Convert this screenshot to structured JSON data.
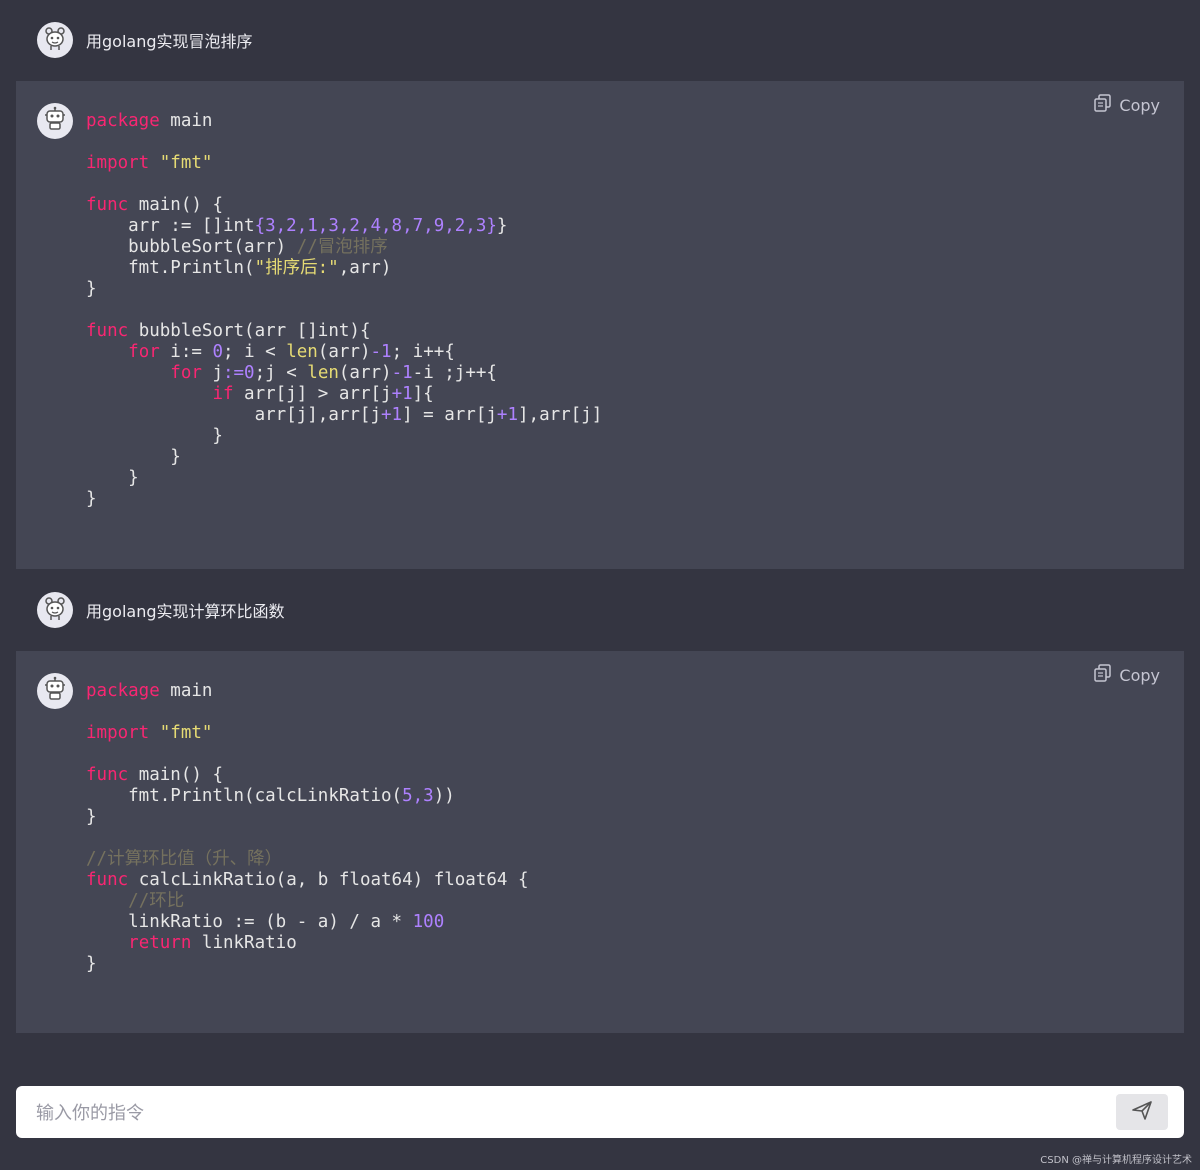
{
  "messages": [
    {
      "user_prompt": "用golang实现冒泡排序",
      "copy_label": "Copy"
    },
    {
      "user_prompt": "用golang实现计算环比函数",
      "copy_label": "Copy"
    }
  ],
  "code1": {
    "l1": [
      "package",
      " main"
    ],
    "l3": [
      "import",
      "\"fmt\""
    ],
    "l5": [
      "func",
      " main() {"
    ],
    "l6": [
      "    arr := []int",
      "{3,2,1,3,2,4,8,7,9,2,3}",
      "}"
    ],
    "l7": [
      "    bubbleSort(arr) ",
      "//冒泡排序"
    ],
    "l8": [
      "    fmt.Println(",
      "\"排序后:\"",
      ",arr)"
    ],
    "l9": "}",
    "l11": [
      "func",
      " bubbleSort(arr []int){"
    ],
    "l12": [
      "    ",
      "for",
      " i:= ",
      "0",
      "; i < ",
      "len",
      "(arr)",
      "-1",
      "; i++{"
    ],
    "l13": [
      "        ",
      "for",
      " j",
      ":=0",
      ";j < ",
      "len",
      "(arr)",
      "-1",
      "-i ;j++{"
    ],
    "l14": [
      "            ",
      "if",
      " arr[j] > arr[j",
      "+1",
      "]{"
    ],
    "l15": [
      "                arr[j],arr[j",
      "+1",
      "] = arr[j",
      "+1",
      "],arr[j]"
    ],
    "l16": "            }",
    "l17": "        }",
    "l18": "    }",
    "l19": "}"
  },
  "code2": {
    "l1": [
      "package",
      " main"
    ],
    "l3": [
      "import",
      "\"fmt\""
    ],
    "l5": [
      "func",
      " main() {"
    ],
    "l6": [
      "    fmt.Println(calcLinkRatio(",
      "5,3",
      "))"
    ],
    "l7": "}",
    "l9": "//计算环比值（升、降）",
    "l10": [
      "func",
      " calcLinkRatio(a, b float64) float64 {"
    ],
    "l11": [
      "    ",
      "//环比"
    ],
    "l12": [
      "    linkRatio := (b - a) / a * ",
      "100"
    ],
    "l13": [
      "    ",
      "return",
      " linkRatio"
    ],
    "l14": "}"
  },
  "input": {
    "placeholder": "输入你的指令"
  },
  "icons": {
    "user_avatar": "robot-face-icon",
    "bot_avatar": "robot-icon",
    "copy": "copy-icon",
    "send": "send-icon"
  },
  "watermark": "CSDN @禅与计算机程序设计艺术",
  "colors": {
    "background": "#343541",
    "bot_block": "#444654",
    "keyword": "#f92672",
    "string": "#e6db74",
    "number": "#ae81ff",
    "comment": "#75715e"
  }
}
